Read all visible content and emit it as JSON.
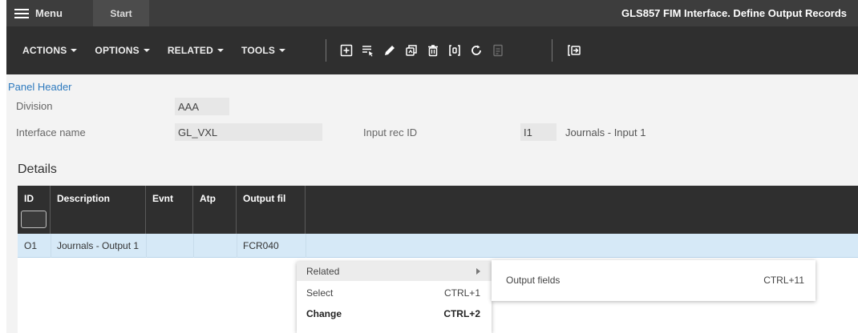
{
  "topbar": {
    "menu_label": "Menu",
    "start_tab": "Start",
    "window_title": "GLS857 FIM Interface. Define Output Records"
  },
  "toolbar": {
    "menus": [
      "ACTIONS",
      "OPTIONS",
      "RELATED",
      "TOOLS"
    ],
    "icons": [
      "create-icon",
      "filter-select-icon",
      "edit-pencil-icon",
      "copy-icon",
      "delete-icon",
      "display-icon",
      "refresh-icon",
      "disabled-doc-icon",
      "exit-icon"
    ]
  },
  "panel": {
    "header": "Panel Header",
    "division_label": "Division",
    "division_value": "AAA",
    "interface_label": "Interface name",
    "interface_value": "GL_VXL",
    "input_rec_label": "Input rec ID",
    "input_rec_value": "I1",
    "input_rec_desc": "Journals - Input 1"
  },
  "details": {
    "title": "Details",
    "columns": [
      "ID",
      "Description",
      "Evnt",
      "Atp",
      "Output fil"
    ],
    "rows": [
      {
        "id": "O1",
        "description": "Journals - Output 1",
        "evnt": "",
        "atp": "",
        "output_file": "FCR040"
      }
    ]
  },
  "context_menu": {
    "items": [
      {
        "label": "Related",
        "shortcut": ""
      },
      {
        "label": "Select",
        "shortcut": "CTRL+1"
      },
      {
        "label": "Change",
        "shortcut": "CTRL+2"
      }
    ]
  },
  "submenu": {
    "label": "Output fields",
    "shortcut": "CTRL+11"
  },
  "colors": {
    "topbar": "#3d3d3d",
    "toolbar": "#2f2f2f",
    "link_blue": "#2f7bbf",
    "selected_row": "#d6e9f7"
  }
}
